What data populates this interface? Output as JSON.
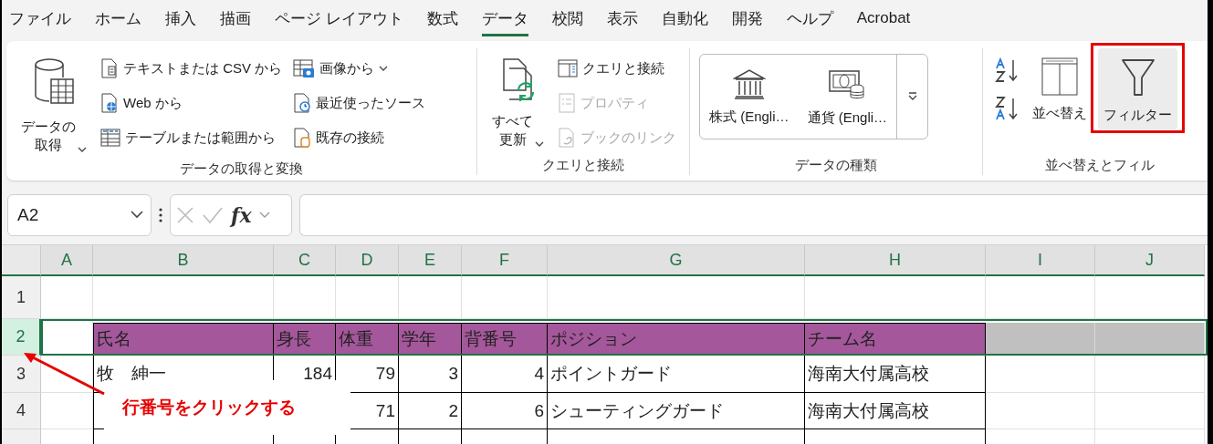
{
  "menu": {
    "tabs": [
      {
        "label": "ファイル",
        "selected": false
      },
      {
        "label": "ホーム",
        "selected": false
      },
      {
        "label": "挿入",
        "selected": false
      },
      {
        "label": "描画",
        "selected": false
      },
      {
        "label": "ページ レイアウト",
        "selected": false
      },
      {
        "label": "数式",
        "selected": false
      },
      {
        "label": "データ",
        "selected": true
      },
      {
        "label": "校閲",
        "selected": false
      },
      {
        "label": "表示",
        "selected": false
      },
      {
        "label": "自動化",
        "selected": false
      },
      {
        "label": "開発",
        "selected": false
      },
      {
        "label": "ヘルプ",
        "selected": false
      },
      {
        "label": "Acrobat",
        "selected": false
      }
    ]
  },
  "ribbon": {
    "groups": [
      {
        "label": "データの取得と変換",
        "items": [
          {
            "kind": "large",
            "label": "データの取得",
            "dropdown": true,
            "highlighted": false,
            "annotated": false
          },
          {
            "kind": "small",
            "label": "テキストまたは CSV から",
            "disabled": false,
            "dropdown": false
          },
          {
            "kind": "small",
            "label": "Web から",
            "disabled": false,
            "dropdown": false
          },
          {
            "kind": "small",
            "label": "テーブルまたは範囲から",
            "disabled": false,
            "dropdown": false
          },
          {
            "kind": "small",
            "label": "画像から",
            "disabled": false,
            "dropdown": true
          },
          {
            "kind": "small",
            "label": "最近使ったソース",
            "disabled": false,
            "dropdown": false
          },
          {
            "kind": "small",
            "label": "既存の接続",
            "disabled": false,
            "dropdown": false
          }
        ]
      },
      {
        "label": "クエリと接続",
        "items": [
          {
            "kind": "large",
            "label": "すべて更新",
            "dropdown": true,
            "highlighted": false,
            "annotated": false
          },
          {
            "kind": "small",
            "label": "クエリと接続",
            "disabled": false,
            "dropdown": false
          },
          {
            "kind": "small",
            "label": "プロパティ",
            "disabled": true,
            "dropdown": false
          },
          {
            "kind": "small",
            "label": "ブックのリンク",
            "disabled": true,
            "dropdown": false
          }
        ]
      },
      {
        "label": "データの種類",
        "items": [
          {
            "kind": "gallery",
            "options": [
              "株式 (Engli…",
              "通貨 (Engli…"
            ]
          }
        ]
      },
      {
        "label": "並べ替えとフィル",
        "items": [
          {
            "kind": "sort"
          },
          {
            "kind": "large",
            "label": "並べ替え",
            "dropdown": false,
            "highlighted": false,
            "annotated": false
          },
          {
            "kind": "large",
            "label": "フィルター",
            "dropdown": false,
            "highlighted": true,
            "annotated": true
          }
        ]
      }
    ]
  },
  "formula_bar": {
    "name_box": "A2",
    "function_label": "fx"
  },
  "sheet": {
    "columns": [
      "A",
      "B",
      "C",
      "D",
      "E",
      "F",
      "G",
      "H",
      "I",
      "J"
    ],
    "rows": [
      {
        "number": "1",
        "selected": false,
        "kind": "blank",
        "cells": {}
      },
      {
        "number": "2",
        "selected": true,
        "kind": "header",
        "cells": {
          "B": "氏名",
          "C": "身長",
          "D": "体重",
          "E": "学年",
          "F": "背番号",
          "G": "ポジション",
          "H": "チーム名"
        }
      },
      {
        "number": "3",
        "selected": false,
        "kind": "data",
        "cells": {
          "B": "牧　紳一",
          "C": "184",
          "D": "79",
          "E": "3",
          "F": "4",
          "G": "ポイントガード",
          "H": "海南大付属高校"
        }
      },
      {
        "number": "4",
        "selected": false,
        "kind": "data",
        "cells": {
          "D": "71",
          "E": "2",
          "F": "6",
          "G": "シューティングガード",
          "H": "海南大付属高校"
        }
      }
    ]
  },
  "callout": {
    "text": "行番号をクリックする"
  }
}
